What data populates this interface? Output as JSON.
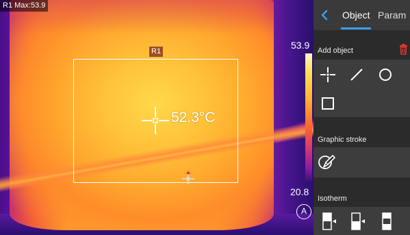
{
  "thermal": {
    "max_label": "R1 Max:53.9",
    "roi_tag": "R1",
    "spot_temperature": "52.3°C",
    "scale_max": "53.9",
    "scale_min": "20.8",
    "auto_mode": "A"
  },
  "panel": {
    "tabs": [
      {
        "label": "Object",
        "active": true
      },
      {
        "label": "Param",
        "active": false
      }
    ],
    "sections": {
      "add_object": "Add object",
      "graphic_stroke": "Graphic stroke",
      "isotherm": "Isotherm"
    },
    "tools": [
      "spot-icon",
      "line-icon",
      "circle-icon",
      "rectangle-icon"
    ],
    "accent": "#3a9ef0",
    "delete_color": "#e53935"
  }
}
